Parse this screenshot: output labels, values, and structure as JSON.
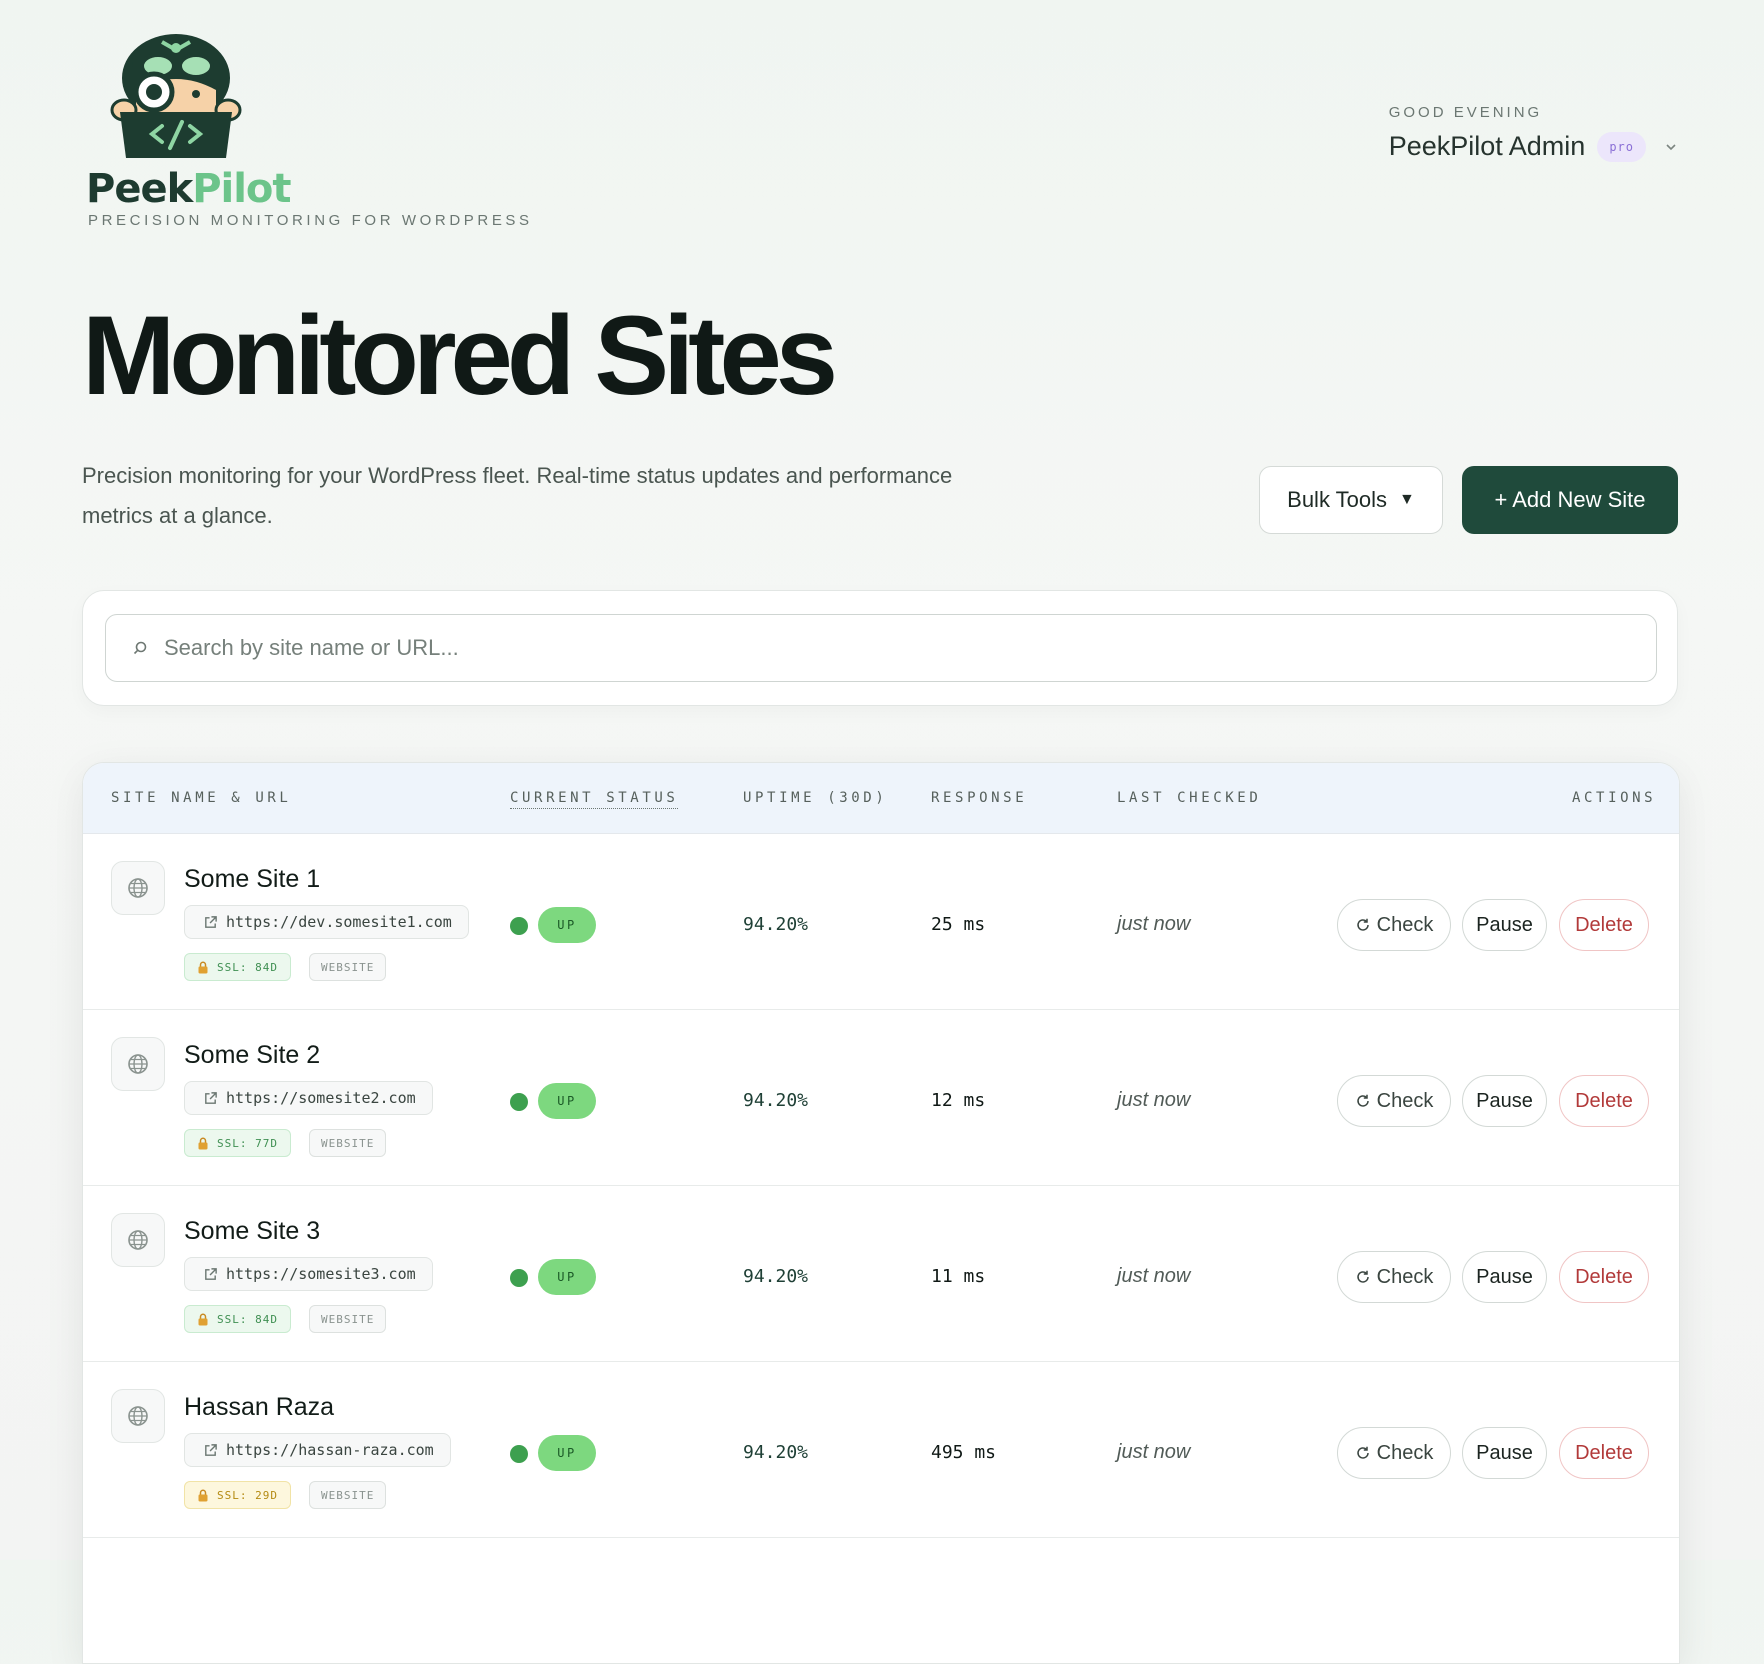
{
  "brand": {
    "name_part1": "Peek",
    "name_part2": "Pilot",
    "tagline": "PRECISION MONITORING FOR WORDPRESS",
    "colors": {
      "primary": "#1f4a3b",
      "accent": "#6cc48a"
    }
  },
  "user": {
    "greeting": "GOOD EVENING",
    "name": "PeekPilot Admin",
    "badge": "pro"
  },
  "page": {
    "title": "Monitored Sites",
    "subtitle": "Precision monitoring for your WordPress fleet. Real-time status updates and performance metrics at a glance."
  },
  "toolbar": {
    "bulk_label": "Bulk Tools",
    "bulk_caret": "▼",
    "add_label": "+ Add New Site"
  },
  "search": {
    "placeholder": "Search by site name or URL..."
  },
  "table": {
    "headers": {
      "site": "SITE NAME & URL",
      "status": "CURRENT STATUS",
      "uptime": "UPTIME (30D)",
      "response": "RESPONSE",
      "checked": "LAST CHECKED",
      "actions": "ACTIONS"
    },
    "rows": [
      {
        "name": "Some Site 1",
        "url": "https://dev.somesite1.com",
        "ssl": "SSL: 84D",
        "ssl_state": "green",
        "type": "WEBSITE",
        "status": "UP",
        "uptime": "94.20%",
        "response": "25 ms",
        "checked": "just now"
      },
      {
        "name": "Some Site 2",
        "url": "https://somesite2.com",
        "ssl": "SSL: 77D",
        "ssl_state": "green",
        "type": "WEBSITE",
        "status": "UP",
        "uptime": "94.20%",
        "response": "12 ms",
        "checked": "just now"
      },
      {
        "name": "Some Site 3",
        "url": "https://somesite3.com",
        "ssl": "SSL: 84D",
        "ssl_state": "green",
        "type": "WEBSITE",
        "status": "UP",
        "uptime": "94.20%",
        "response": "11 ms",
        "checked": "just now"
      },
      {
        "name": "Hassan Raza",
        "url": "https://hassan-raza.com",
        "ssl": "SSL: 29D",
        "ssl_state": "yellow",
        "type": "WEBSITE",
        "status": "UP",
        "uptime": "94.20%",
        "response": "495 ms",
        "checked": "just now"
      }
    ],
    "actions": {
      "check": "Check",
      "pause": "Pause",
      "delete": "Delete"
    }
  }
}
